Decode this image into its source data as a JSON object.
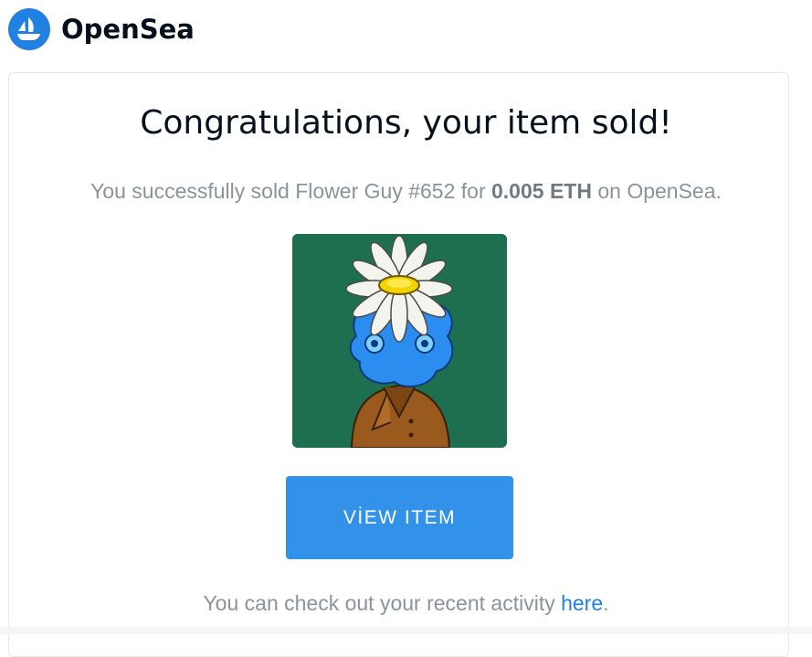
{
  "brand": {
    "name": "OpenSea",
    "accent": "#2081e2"
  },
  "email": {
    "title": "Congratulations, your item sold!",
    "message_prefix": "You successfully sold Flower Guy #652 for ",
    "price": "0.005 ETH",
    "message_suffix": " on OpenSea.",
    "nft_image": "flower-guy-nft-image",
    "button_label": "VİEW ITEM",
    "footer_prefix": "You can check out your recent activity ",
    "footer_link": "here",
    "footer_suffix": "."
  }
}
